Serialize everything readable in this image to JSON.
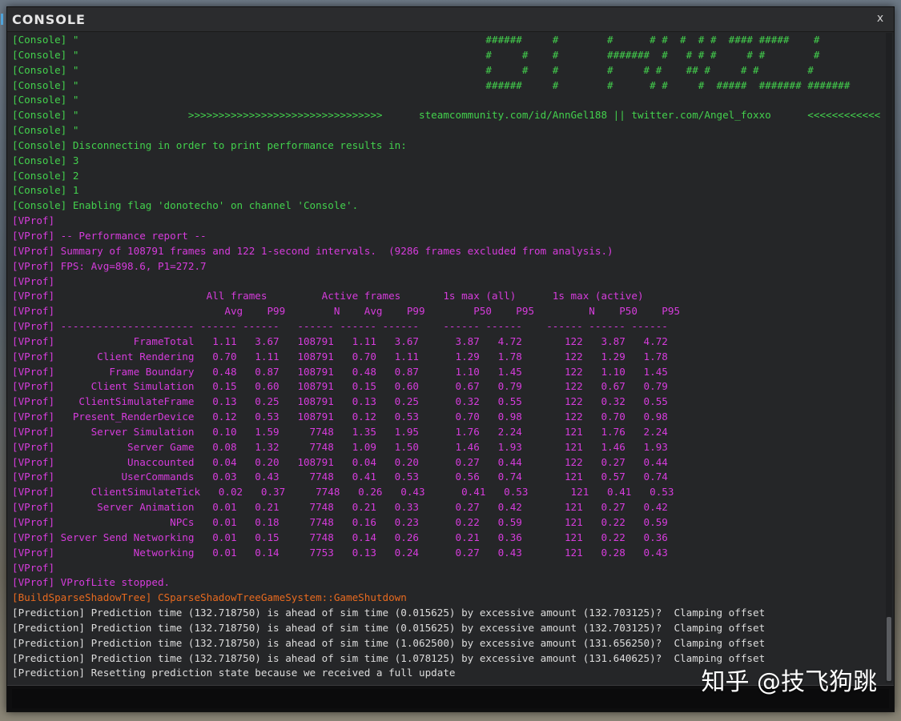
{
  "window": {
    "title": "CONSOLE",
    "close_label": "x"
  },
  "colors": {
    "console": "#43d14d",
    "vprof": "#d63cdc",
    "build": "#e86a1f",
    "prediction": "#dddddd"
  },
  "log": [
    {
      "c": "console",
      "t": "[Console] \"                                                                   ######     #        #      # #  #  # #  #### #####    #"
    },
    {
      "c": "console",
      "t": "[Console] \"                                                                   #     #    #        #######  #   # # #     # #        #"
    },
    {
      "c": "console",
      "t": "[Console] \"                                                                   #     #    #        #     # #    ## #     # #        #"
    },
    {
      "c": "console",
      "t": "[Console] \"                                                                   ######     #        #      # #     #  #####  ####### #######"
    },
    {
      "c": "console",
      "t": "[Console] \""
    },
    {
      "c": "console",
      "t": "[Console] \"                  >>>>>>>>>>>>>>>>>>>>>>>>>>>>>>>>      steamcommunity.com/id/AnnGel188 || twitter.com/Angel_foxxo      <<<<<<<<<<<<"
    },
    {
      "c": "console",
      "t": "[Console] \""
    },
    {
      "c": "console",
      "t": "[Console] Disconnecting in order to print performance results in:"
    },
    {
      "c": "console",
      "t": "[Console] 3"
    },
    {
      "c": "console",
      "t": "[Console] 2"
    },
    {
      "c": "console",
      "t": "[Console] 1"
    },
    {
      "c": "console",
      "t": "[Console] Enabling flag 'donotecho' on channel 'Console'."
    },
    {
      "c": "vprof",
      "t": "[VProf]"
    },
    {
      "c": "vprof",
      "t": "[VProf] -- Performance report --"
    },
    {
      "c": "vprof",
      "t": "[VProf] Summary of 108791 frames and 122 1-second intervals.  (9286 frames excluded from analysis.)"
    },
    {
      "c": "vprof",
      "t": "[VProf] FPS: Avg=898.6, P1=272.7"
    },
    {
      "c": "vprof",
      "t": "[VProf]"
    },
    {
      "c": "vprof",
      "t": "[VProf]                         All frames         Active frames       1s max (all)      1s max (active)"
    },
    {
      "c": "vprof",
      "t": "[VProf]                            Avg    P99        N    Avg    P99        P50    P95         N    P50    P95"
    },
    {
      "c": "vprof",
      "t": "[VProf] ---------------------- ------ ------   ------ ------ ------    ------ ------    ------ ------ ------"
    },
    {
      "c": "vprof",
      "t": "[VProf]             FrameTotal   1.11   3.67   108791   1.11   3.67      3.87   4.72       122   3.87   4.72"
    },
    {
      "c": "vprof",
      "t": "[VProf]       Client Rendering   0.70   1.11   108791   0.70   1.11      1.29   1.78       122   1.29   1.78"
    },
    {
      "c": "vprof",
      "t": "[VProf]         Frame Boundary   0.48   0.87   108791   0.48   0.87      1.10   1.45       122   1.10   1.45"
    },
    {
      "c": "vprof",
      "t": "[VProf]      Client Simulation   0.15   0.60   108791   0.15   0.60      0.67   0.79       122   0.67   0.79"
    },
    {
      "c": "vprof",
      "t": "[VProf]    ClientSimulateFrame   0.13   0.25   108791   0.13   0.25      0.32   0.55       122   0.32   0.55"
    },
    {
      "c": "vprof",
      "t": "[VProf]   Present_RenderDevice   0.12   0.53   108791   0.12   0.53      0.70   0.98       122   0.70   0.98"
    },
    {
      "c": "vprof",
      "t": "[VProf]      Server Simulation   0.10   1.59     7748   1.35   1.95      1.76   2.24       121   1.76   2.24"
    },
    {
      "c": "vprof",
      "t": "[VProf]            Server Game   0.08   1.32     7748   1.09   1.50      1.46   1.93       121   1.46   1.93"
    },
    {
      "c": "vprof",
      "t": "[VProf]            Unaccounted   0.04   0.20   108791   0.04   0.20      0.27   0.44       122   0.27   0.44"
    },
    {
      "c": "vprof",
      "t": "[VProf]           UserCommands   0.03   0.43     7748   0.41   0.53      0.56   0.74       121   0.57   0.74"
    },
    {
      "c": "vprof",
      "t": "[VProf]      ClientSimulateTick   0.02   0.37     7748   0.26   0.43      0.41   0.53       121   0.41   0.53"
    },
    {
      "c": "vprof",
      "t": "[VProf]       Server Animation   0.01   0.21     7748   0.21   0.33      0.27   0.42       121   0.27   0.42"
    },
    {
      "c": "vprof",
      "t": "[VProf]                   NPCs   0.01   0.18     7748   0.16   0.23      0.22   0.59       121   0.22   0.59"
    },
    {
      "c": "vprof",
      "t": "[VProf] Server Send Networking   0.01   0.15     7748   0.14   0.26      0.21   0.36       121   0.22   0.36"
    },
    {
      "c": "vprof",
      "t": "[VProf]             Networking   0.01   0.14     7753   0.13   0.24      0.27   0.43       121   0.28   0.43"
    },
    {
      "c": "vprof",
      "t": "[VProf]"
    },
    {
      "c": "vprof",
      "t": "[VProf] VProfLite stopped."
    },
    {
      "c": "build",
      "t": "[BuildSparseShadowTree] CSparseShadowTreeGameSystem::GameShutdown"
    },
    {
      "c": "pred",
      "t": "[Prediction] Prediction time (132.718750) is ahead of sim time (0.015625) by excessive amount (132.703125)?  Clamping offset"
    },
    {
      "c": "pred",
      "t": "[Prediction] Prediction time (132.718750) is ahead of sim time (0.015625) by excessive amount (132.703125)?  Clamping offset"
    },
    {
      "c": "pred",
      "t": "[Prediction] Prediction time (132.718750) is ahead of sim time (1.062500) by excessive amount (131.656250)?  Clamping offset"
    },
    {
      "c": "pred",
      "t": "[Prediction] Prediction time (132.718750) is ahead of sim time (1.078125) by excessive amount (131.640625)?  Clamping offset"
    },
    {
      "c": "pred",
      "t": "[Prediction] Resetting prediction state because we received a full update"
    }
  ],
  "input": {
    "value": "",
    "placeholder": ""
  },
  "watermark": "知乎 @技飞狗跳"
}
